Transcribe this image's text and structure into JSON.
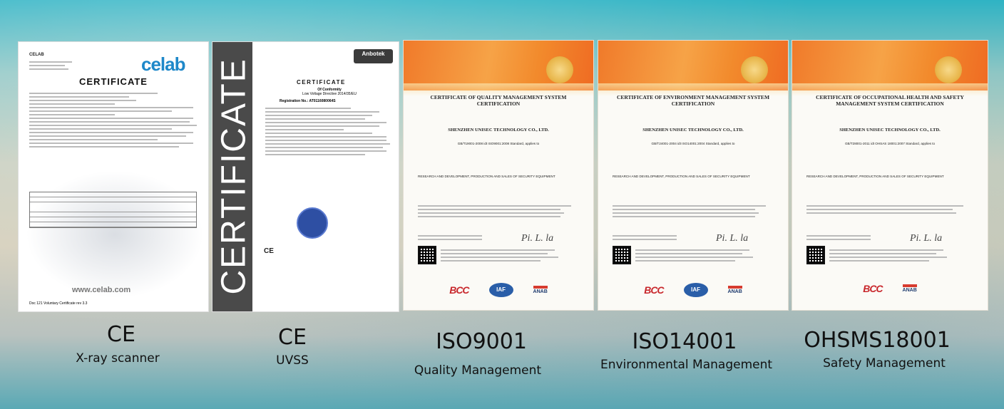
{
  "certificates": [
    {
      "brand": "CELAB",
      "logo": "celab",
      "title": "CERTIFICATE",
      "url": "www.celab.com",
      "doc_line": "Doc 121 Voluntary Certificate rev 3.3",
      "caption_main": "CE",
      "caption_sub": "X-ray scanner"
    },
    {
      "logo": "Anbotek",
      "band_text": "CERTIFICATE",
      "title": "CERTIFICATE",
      "subtitle": "Of Conformity",
      "directive": "Low Voltage Directive 2014/35/EU",
      "registration": "Registration No.:  AT0116080064S",
      "ce_mark": "CE",
      "caption_main": "CE",
      "caption_sub": "UVSS"
    },
    {
      "title": "CERTIFICATE OF QUALITY MANAGEMENT SYSTEM CERTIFICATION",
      "company": "SHENZHEN UNISEC TECHNOLOGY CO., LTD.",
      "standard": "GB/T19001-2008 idt ISO9001:2008 Standard, applies to",
      "scope": "RESEARCH AND DEVELOPMENT, PRODUCTION AND SALES OF SECURITY EQUIPMENT",
      "signature": "Pi. L. la",
      "caption_main": "ISO9001",
      "caption_sub": "Quality Management"
    },
    {
      "title": "CERTIFICATE OF ENVIRONMENT MANAGEMENT SYSTEM CERTIFICATION",
      "company": "SHENZHEN UNISEC TECHNOLOGY CO., LTD.",
      "standard": "GB/T24001-2004 idt ISO14001:2004 Standard, applies to",
      "scope": "RESEARCH AND DEVELOPMENT, PRODUCTION AND SALES OF SECURITY EQUIPMENT",
      "signature": "Pi. L. la",
      "caption_main": "ISO14001",
      "caption_sub": "Environmental Management"
    },
    {
      "title": "CERTIFICATE OF OCCUPATIONAL HEALTH AND SAFETY MANAGEMENT SYSTEM CERTIFICATION",
      "company": "SHENZHEN UNISEC TECHNOLOGY CO., LTD.",
      "standard": "GB/T28001-2011 idt OHSAS 18001:2007 Standard, applies to",
      "scope": "RESEARCH AND DEVELOPMENT, PRODUCTION AND SALES OF SECURITY EQUIPMENT",
      "signature": "Pi. L. la",
      "caption_main": "OHSMS18001",
      "caption_sub": "Safety Management"
    }
  ],
  "logos": {
    "bcc": "BCC",
    "iaf": "IAF",
    "anab": "ANAB"
  }
}
